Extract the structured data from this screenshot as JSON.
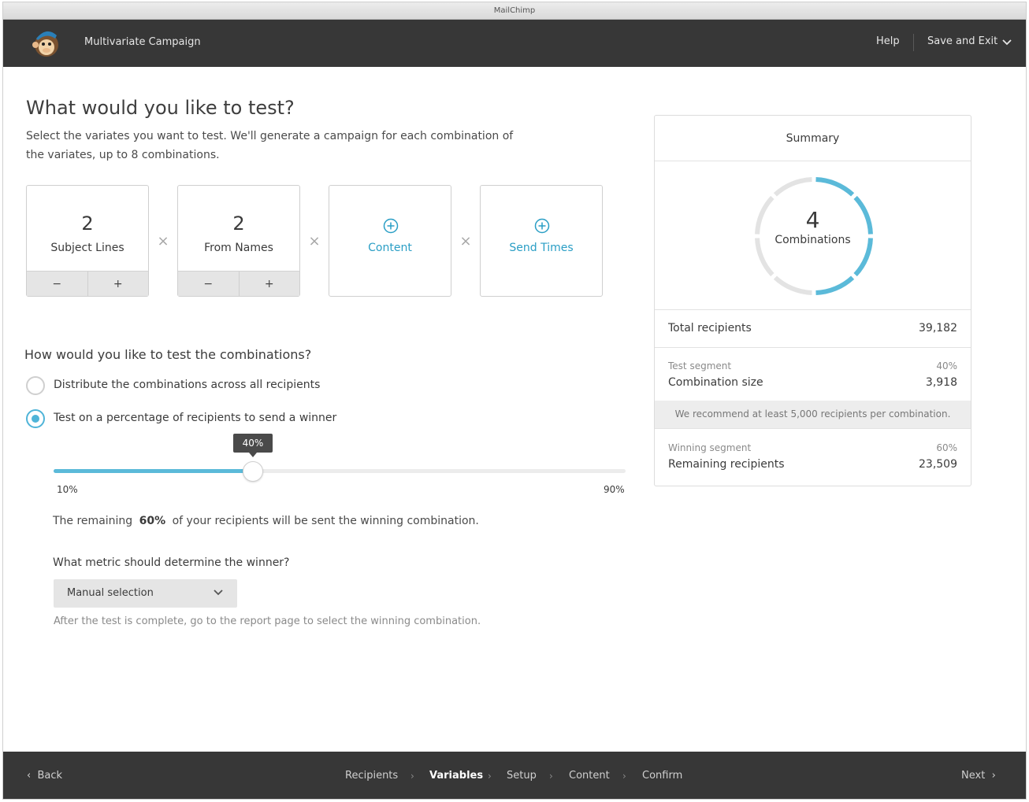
{
  "window": {
    "title": "MailChimp"
  },
  "header": {
    "app_title": "Multivariate  Campaign",
    "help_label": "Help",
    "save_exit_label": "Save and Exit",
    "logo_icon": "freddie-chimp-logo",
    "chevron_icon": "chevron-down-icon"
  },
  "main": {
    "title": "What would you like to test?",
    "intro": "Select the variates you want to test. We'll generate a campaign for each combination of the variates, up to 8 combinations.",
    "variates": [
      {
        "count": "2",
        "label": "Subject Lines",
        "minus": "−",
        "plus": "+"
      },
      {
        "count": "2",
        "label": "From Names",
        "minus": "−",
        "plus": "+"
      },
      {
        "label": "Content",
        "icon": "add-circle-icon"
      },
      {
        "label": "Send Times",
        "icon": "add-circle-icon"
      }
    ],
    "multiply_symbol": "×",
    "test_question": "How would you like to test the combinations?",
    "options": [
      {
        "label": "Distribute the combinations across all recipients",
        "selected": false
      },
      {
        "label": "Test on a percentage of recipients to send a winner",
        "selected": true
      }
    ],
    "slider": {
      "value_label": "40%",
      "value_percent": 40,
      "min_label": "10%",
      "max_label": "90%",
      "min_value": 10,
      "max_value": 90
    },
    "remaining": {
      "prefix": "The remaining",
      "percent": "60%",
      "suffix": "of your recipients will be sent the winning combination."
    },
    "metric": {
      "question": "What metric should determine the winner?",
      "selected": "Manual selection",
      "help": "After the test is complete, go to the report page to select the winning combination."
    }
  },
  "summary": {
    "title": "Summary",
    "combinations_count": "4",
    "combinations_label": "Combinations",
    "ring_segments": 8,
    "ring_filled": 4,
    "accent_color": "#5bbad9",
    "total_recipients_label": "Total recipients",
    "total_recipients_value": "39,182",
    "test_segment_label": "Test segment",
    "test_segment_percent": "40%",
    "combination_size_label": "Combination size",
    "combination_size_value": "3,918",
    "recommend": "We recommend at least 5,000 recipients per combination.",
    "winning_segment_label": "Winning segment",
    "winning_segment_percent": "60%",
    "remaining_recipients_label": "Remaining recipients",
    "remaining_recipients_value": "23,509"
  },
  "footer": {
    "back_label": "Back",
    "next_label": "Next",
    "steps": [
      "Recipients",
      "Variables",
      "Setup",
      "Content",
      "Confirm"
    ],
    "active_step": "Variables"
  }
}
